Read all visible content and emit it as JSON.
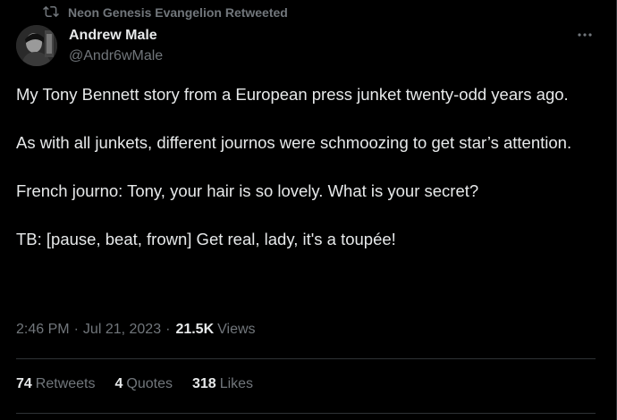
{
  "retweet": {
    "icon": "retweet-icon",
    "text": "Neon Genesis Evangelion Retweeted"
  },
  "author": {
    "name": "Andrew Male",
    "handle": "@Andr6wMale",
    "avatar_icon": "avatar"
  },
  "menu": {
    "icon": "more-icon"
  },
  "tweet": {
    "paragraphs": [
      "My Tony Bennett story from a European press junket twenty-odd years ago.",
      "As with all junkets, different journos were schmoozing to get star’s attention.",
      "French journo: Tony, your hair is so lovely. What is your secret?",
      "TB: [pause, beat, frown] Get real, lady, it's a toupée!"
    ]
  },
  "meta": {
    "time": "2:46 PM",
    "separator": "·",
    "date": "Jul 21, 2023",
    "views_count": "21.5K",
    "views_label": "Views"
  },
  "stats": {
    "retweets_count": "74",
    "retweets_label": "Retweets",
    "quotes_count": "4",
    "quotes_label": "Quotes",
    "likes_count": "318",
    "likes_label": "Likes"
  },
  "colors": {
    "background": "#000000",
    "text": "#e7e9ea",
    "secondary": "#71767b",
    "divider": "#2f3336"
  }
}
